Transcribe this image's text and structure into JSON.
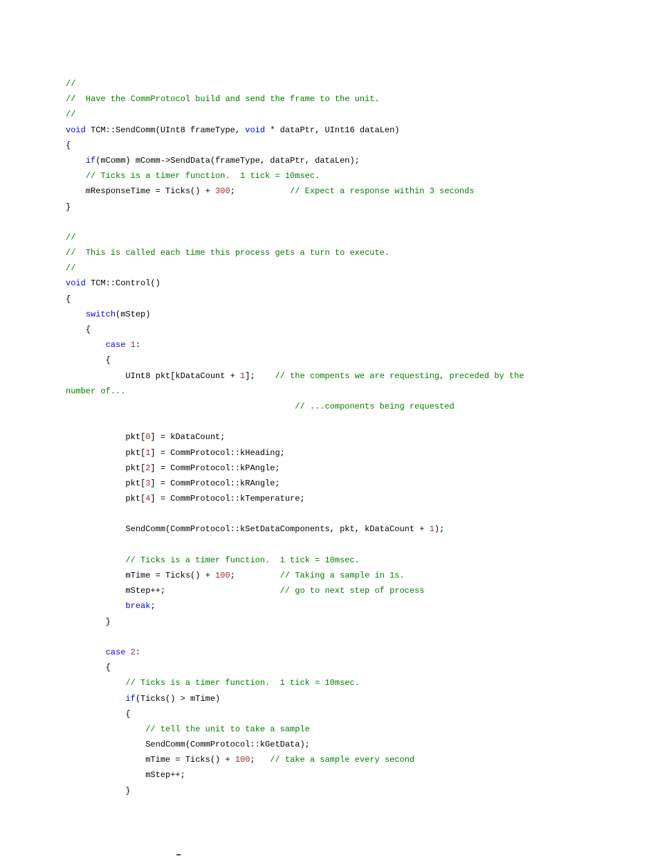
{
  "lines": [
    [
      {
        "t": "//",
        "c": "cmt"
      }
    ],
    [
      {
        "t": "//  Have the CommProtocol build and send the frame to the unit.",
        "c": "cmt"
      }
    ],
    [
      {
        "t": "//",
        "c": "cmt"
      }
    ],
    [
      {
        "t": "void",
        "c": "kw"
      },
      {
        "t": " TCM::SendComm(UInt8 frameType, "
      },
      {
        "t": "void",
        "c": "kw"
      },
      {
        "t": " * dataPtr, UInt16 dataLen)"
      }
    ],
    [
      {
        "t": "{"
      }
    ],
    [
      {
        "t": "    "
      },
      {
        "t": "if",
        "c": "kw"
      },
      {
        "t": "(mComm) mComm->SendData(frameType, dataPtr, dataLen);"
      }
    ],
    [
      {
        "t": "    "
      },
      {
        "t": "// Ticks is a timer function.  1 tick = 10msec.",
        "c": "cmt"
      }
    ],
    [
      {
        "t": "    mResponseTime = Ticks() + "
      },
      {
        "t": "300",
        "c": "num"
      },
      {
        "t": ";           "
      },
      {
        "t": "// Expect a response within 3 seconds",
        "c": "cmt"
      }
    ],
    [
      {
        "t": "}"
      }
    ],
    [
      {
        "t": ""
      }
    ],
    [
      {
        "t": "//",
        "c": "cmt"
      }
    ],
    [
      {
        "t": "//  This is called each time this process gets a turn to execute.",
        "c": "cmt"
      }
    ],
    [
      {
        "t": "//",
        "c": "cmt"
      }
    ],
    [
      {
        "t": "void",
        "c": "kw"
      },
      {
        "t": " TCM::Control()"
      }
    ],
    [
      {
        "t": "{"
      }
    ],
    [
      {
        "t": "    "
      },
      {
        "t": "switch",
        "c": "kw"
      },
      {
        "t": "(mStep)"
      }
    ],
    [
      {
        "t": "    {"
      }
    ],
    [
      {
        "t": "        "
      },
      {
        "t": "case",
        "c": "kw"
      },
      {
        "t": " "
      },
      {
        "t": "1",
        "c": "num"
      },
      {
        "t": ":"
      }
    ],
    [
      {
        "t": "        {"
      }
    ],
    [
      {
        "t": "            UInt8 pkt[kDataCount + "
      },
      {
        "t": "1",
        "c": "num"
      },
      {
        "t": "];    "
      },
      {
        "t": "// the compents we are requesting, preceded by the",
        "c": "cmt"
      }
    ]
  ],
  "wrapline": [
    {
      "t": "number of...",
      "c": "cmt"
    }
  ],
  "lines2": [
    [
      {
        "t": "                                              "
      },
      {
        "t": "// ...components being requested",
        "c": "cmt"
      }
    ],
    [
      {
        "t": ""
      }
    ],
    [
      {
        "t": "            pkt["
      },
      {
        "t": "0",
        "c": "num"
      },
      {
        "t": "] = kDataCount;"
      }
    ],
    [
      {
        "t": "            pkt["
      },
      {
        "t": "1",
        "c": "num"
      },
      {
        "t": "] = CommProtocol::kHeading;"
      }
    ],
    [
      {
        "t": "            pkt["
      },
      {
        "t": "2",
        "c": "num"
      },
      {
        "t": "] = CommProtocol::kPAngle;"
      }
    ],
    [
      {
        "t": "            pkt["
      },
      {
        "t": "3",
        "c": "num"
      },
      {
        "t": "] = CommProtocol::kRAngle;"
      }
    ],
    [
      {
        "t": "            pkt["
      },
      {
        "t": "4",
        "c": "num"
      },
      {
        "t": "] = CommProtocol::kTemperature;"
      }
    ],
    [
      {
        "t": ""
      }
    ],
    [
      {
        "t": "            SendComm(CommProtocol::kSetDataComponents, pkt, kDataCount + "
      },
      {
        "t": "1",
        "c": "num"
      },
      {
        "t": ");"
      }
    ],
    [
      {
        "t": ""
      }
    ],
    [
      {
        "t": "            "
      },
      {
        "t": "// Ticks is a timer function.  1 tick = 10msec.",
        "c": "cmt"
      }
    ],
    [
      {
        "t": "            mTime = Ticks() + "
      },
      {
        "t": "100",
        "c": "num"
      },
      {
        "t": ";         "
      },
      {
        "t": "// Taking a sample in 1s.",
        "c": "cmt"
      }
    ],
    [
      {
        "t": "            mStep++;                       "
      },
      {
        "t": "// go to next step of process",
        "c": "cmt"
      }
    ],
    [
      {
        "t": "            "
      },
      {
        "t": "break",
        "c": "kw"
      },
      {
        "t": ";"
      }
    ],
    [
      {
        "t": "        }"
      }
    ],
    [
      {
        "t": ""
      }
    ],
    [
      {
        "t": "        "
      },
      {
        "t": "case",
        "c": "kw"
      },
      {
        "t": " "
      },
      {
        "t": "2",
        "c": "num"
      },
      {
        "t": ":"
      }
    ],
    [
      {
        "t": "        {"
      }
    ],
    [
      {
        "t": "            "
      },
      {
        "t": "// Ticks is a timer function.  1 tick = 10msec.",
        "c": "cmt"
      }
    ],
    [
      {
        "t": "            "
      },
      {
        "t": "if",
        "c": "kw"
      },
      {
        "t": "(Ticks() > mTime)"
      }
    ],
    [
      {
        "t": "            {"
      }
    ],
    [
      {
        "t": "                "
      },
      {
        "t": "// tell the unit to take a sample",
        "c": "cmt"
      }
    ],
    [
      {
        "t": "                SendComm(CommProtocol::kGetData);"
      }
    ],
    [
      {
        "t": "                mTime = Ticks() + "
      },
      {
        "t": "100",
        "c": "num"
      },
      {
        "t": ";   "
      },
      {
        "t": "// take a sample every second",
        "c": "cmt"
      }
    ],
    [
      {
        "t": "                mStep++;"
      }
    ],
    [
      {
        "t": "            }"
      }
    ]
  ],
  "footer": "–"
}
